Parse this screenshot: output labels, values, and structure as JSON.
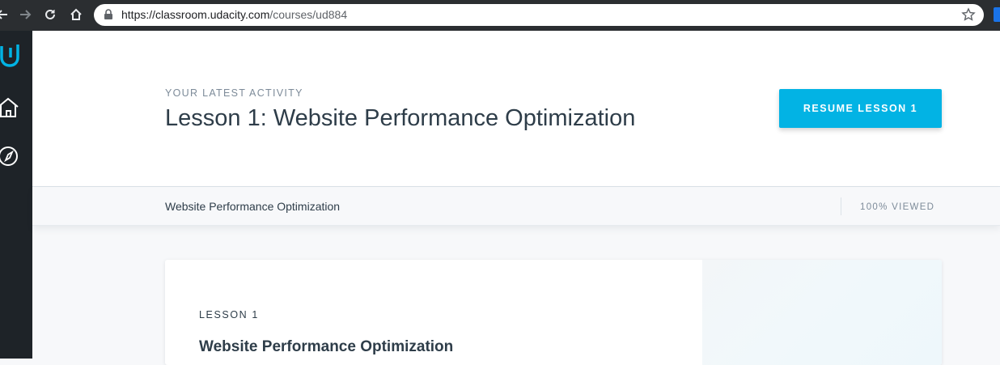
{
  "browser": {
    "url_host": "https://classroom.udacity.com",
    "url_path": "/courses/ud884"
  },
  "icons": {
    "back": "arrow-left-icon",
    "forward": "arrow-right-icon",
    "reload": "reload-icon",
    "home": "home-icon",
    "lock": "lock-icon",
    "bookmark": "star-icon",
    "logo": "udacity-logo-icon",
    "rail_home": "home-icon",
    "rail_explore": "compass-icon"
  },
  "colors": {
    "accent": "#02b3e4",
    "rail": "#1e2328",
    "text": "#2e3d49",
    "muted": "#7d8b99"
  },
  "hero": {
    "eyebrow": "YOUR LATEST ACTIVITY",
    "title": "Lesson 1: Website Performance Optimization",
    "resume_label": "RESUME LESSON 1"
  },
  "subbar": {
    "course_name": "Website Performance Optimization",
    "viewed_status": "100% VIEWED"
  },
  "card": {
    "lesson_label": "LESSON 1",
    "lesson_title": "Website Performance Optimization"
  }
}
